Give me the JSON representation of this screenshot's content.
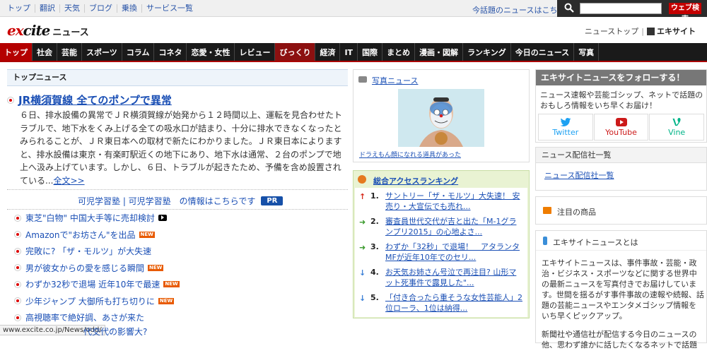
{
  "topbar": {
    "links": [
      "トップ",
      "翻訳",
      "天気",
      "ブログ",
      "乗換",
      "サービス一覧"
    ],
    "trending": "今話題のニュースはこちら",
    "search_placeholder": "",
    "search_button": "ウェブ検索"
  },
  "header": {
    "logo_main_a": "e",
    "logo_main_b": "x",
    "logo_main_c": "cite",
    "logo_sub": "ニュース",
    "news_top": "ニューストップ",
    "excite_home": "エキサイト"
  },
  "nav": [
    "トップ",
    "社会",
    "芸能",
    "スポーツ",
    "コラム",
    "コネタ",
    "恋愛・女性",
    "レビュー",
    "びっくり",
    "経済",
    "IT",
    "国際",
    "まとめ",
    "漫画・図解",
    "ランキング",
    "今日のニュース",
    "写真"
  ],
  "top_news": {
    "section_title": "トップニュース",
    "headline": "JR横須賀線 全てのポンプで異常",
    "summary": "６日、排水設備の異常でＪＲ横須賀線が始発から１２時間以上、運転を見合わせたトラブルで、地下水をくみ上げる全ての吸水口が詰まり、十分に排水できなくなったとみられることが、ＪＲ東日本への取材で新たにわかりました。ＪＲ東日本によりますと、排水設備は東京・有楽町駅近くの地下にあり、地下水は通常、２台のポンプで地上へ汲み上げています。しかし、６日、トラブルが起きたため、予備を含め設置されている...",
    "more": "全文>>"
  },
  "pr": {
    "text": "可児学習塾 | 可児学習塾　の情報はこちらです",
    "badge": "PR"
  },
  "news_list": [
    {
      "title": "東芝\"白物\" 中国大手等に売却検討",
      "badge": "video"
    },
    {
      "title": "Amazonで\"お坊さん\"を出品",
      "badge": "NEW"
    },
    {
      "title": "完敗に? 「ザ・モルツ」が大失速",
      "badge": ""
    },
    {
      "title": "男が彼女からの愛を感じる瞬間",
      "badge": "NEW"
    },
    {
      "title": "わずか32秒で退場 近年10年で最速",
      "badge": "NEW"
    },
    {
      "title": "少年ジャンプ 大御所も打ち切りに",
      "badge": "NEW"
    },
    {
      "title": "高視聴率で絶好調、あさが来た",
      "badge": ""
    }
  ],
  "news_badge_label": "NEW",
  "status_url": "www.excite.co.jp/News/odd/",
  "last_item": "代交代の影響大?",
  "photo": {
    "title": "写真ニュース",
    "caption": "ドラえもん顔になれる道具があった"
  },
  "ranking": {
    "title": "総合アクセスランキング",
    "items": [
      {
        "rank": "1.",
        "arrow": "↑",
        "color": "#d62b1c",
        "text": "サントリー「ザ・モルツ」大失速！ 安売り・大宣伝でも売れ..."
      },
      {
        "rank": "2.",
        "arrow": "➜",
        "color": "#3a9a2c",
        "text": "審査員世代交代が吉と出た「M-1グランプリ2015」の心地よさ..."
      },
      {
        "rank": "3.",
        "arrow": "➜",
        "color": "#3a9a2c",
        "text": "わずか「32秒」で退場！　アタランタMFが近年10年でのセリ..."
      },
      {
        "rank": "4.",
        "arrow": "↓",
        "color": "#3a7fd6",
        "text": "お天気お姉さん号泣で再注目? 山形マット死事件で露見した\"..."
      },
      {
        "rank": "5.",
        "arrow": "↓",
        "color": "#3a7fd6",
        "text": "「付き合ったら重そうな女性芸能人」2位ローラ、1位は納得..."
      }
    ]
  },
  "follow": {
    "title": "エキサイトニュースをフォローする！",
    "text": "ニュース速報や芸能ゴシップ、ネットで話題のおもしろ情報をいち早くお届け！",
    "twitter": "Twitter",
    "youtube": "YouTube",
    "vine": "Vine",
    "twitter_color": "#1da1f2",
    "youtube_color": "#cc1a1a",
    "vine_color": "#00b488"
  },
  "distributors": {
    "title": "ニュース配信社一覧",
    "link": "ニュース配信社一覧"
  },
  "shop": {
    "title": "注目の商品"
  },
  "about": {
    "title": "エキサイトニュースとは",
    "p1": "エキサイトニュースは、事件事故・芸能・政治・ビジネス・スポーツなどに関する世界中の最新ニュースを写真付きでお届けしています。世間を揺るがす事件事故の速報や続報、話題の芸能ニュースやエンタメゴシップ情報をいち早くピックアップ。",
    "p2": "新聞社や通信社が配信する今日のニュースの他、思わず誰かに話したくなるネットで話題"
  }
}
